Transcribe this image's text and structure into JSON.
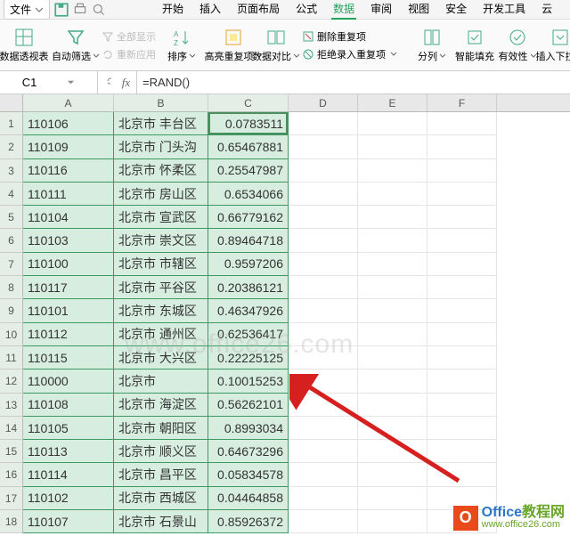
{
  "menu": {
    "file": "文件",
    "tabs": [
      "开始",
      "插入",
      "页面布局",
      "公式",
      "数据",
      "审阅",
      "视图",
      "安全",
      "开发工具",
      "云"
    ]
  },
  "toolbar": {
    "pivot": "数据透视表",
    "autofilter": "自动筛选",
    "show_all": "全部显示",
    "reapply": "重新应用",
    "sort": "排序",
    "highlight_dup": "高亮重复项",
    "data_compare": "数据对比",
    "remove_dup": "删除重复项",
    "reject_dup": "拒绝录入重复项",
    "text_to_cols": "分列",
    "smart_fill": "智能填充",
    "validation": "有效性",
    "insert_dropdown": "插入下拉列"
  },
  "namebox": "C1",
  "fx": "fx",
  "formula": "=RAND()",
  "columns": [
    "A",
    "B",
    "C",
    "D",
    "E",
    "F"
  ],
  "chart_data": {
    "type": "table",
    "columns": [
      "A",
      "B",
      "C"
    ],
    "rows": [
      {
        "a": "110106",
        "b": "北京市 丰台区",
        "c": "0.0783511"
      },
      {
        "a": "110109",
        "b": "北京市 门头沟",
        "c": "0.65467881"
      },
      {
        "a": "110116",
        "b": "北京市 怀柔区",
        "c": "0.25547987"
      },
      {
        "a": "110111",
        "b": "北京市 房山区",
        "c": "0.6534066"
      },
      {
        "a": "110104",
        "b": "北京市 宣武区",
        "c": "0.66779162"
      },
      {
        "a": "110103",
        "b": "北京市 崇文区",
        "c": "0.89464718"
      },
      {
        "a": "110100",
        "b": "北京市 市辖区",
        "c": "0.9597206"
      },
      {
        "a": "110117",
        "b": "北京市 平谷区",
        "c": "0.20386121"
      },
      {
        "a": "110101",
        "b": "北京市 东城区",
        "c": "0.46347926"
      },
      {
        "a": "110112",
        "b": "北京市 通州区",
        "c": "0.62536417"
      },
      {
        "a": "110115",
        "b": "北京市 大兴区",
        "c": "0.22225125"
      },
      {
        "a": "110000",
        "b": "北京市",
        "c": "0.10015253"
      },
      {
        "a": "110108",
        "b": "北京市 海淀区",
        "c": "0.56262101"
      },
      {
        "a": "110105",
        "b": "北京市 朝阳区",
        "c": "0.8993034"
      },
      {
        "a": "110113",
        "b": "北京市 顺义区",
        "c": "0.64673296"
      },
      {
        "a": "110114",
        "b": "北京市 昌平区",
        "c": "0.05834578"
      },
      {
        "a": "110102",
        "b": "北京市 西城区",
        "c": "0.04464858"
      },
      {
        "a": "110107",
        "b": "北京市 石景山",
        "c": "0.85926372"
      }
    ]
  },
  "watermark": "www.office26.com",
  "logo": {
    "badge": "O",
    "main_blue": "Office",
    "main_green": "教程网",
    "sub": "www.office26.com"
  }
}
